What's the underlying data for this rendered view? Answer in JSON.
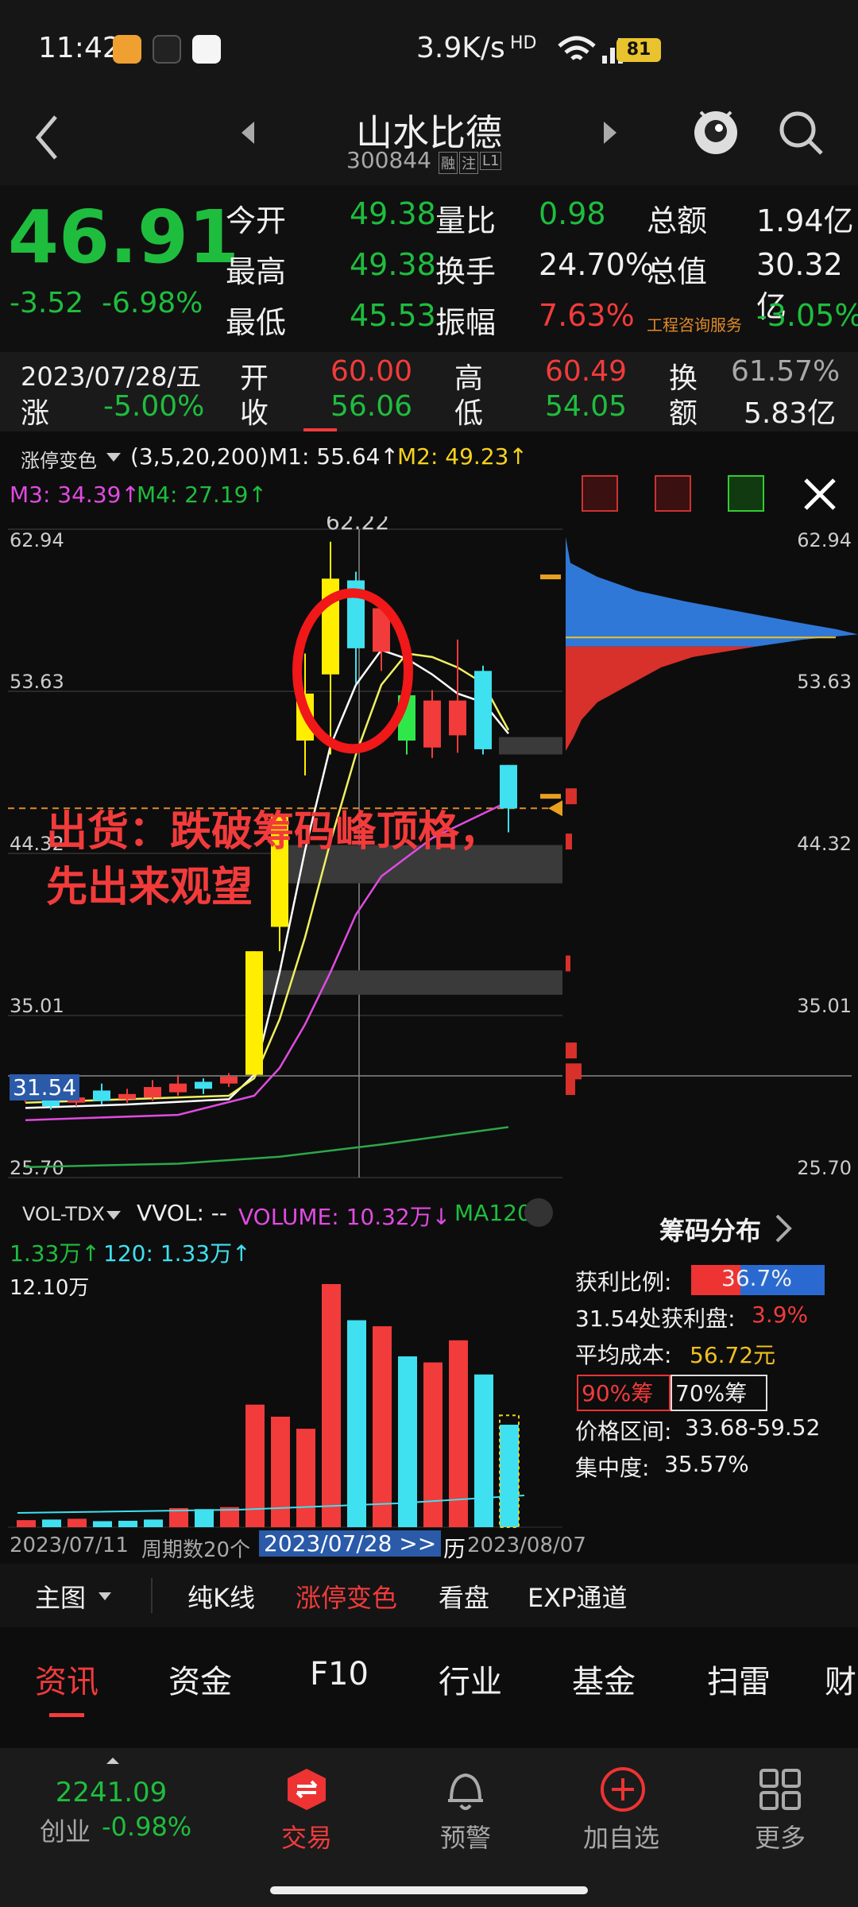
{
  "status": {
    "time": "11:42",
    "speed": "3.9K/s",
    "network": "HD",
    "battery": "81"
  },
  "header": {
    "title": "山水比德",
    "code": "300844",
    "badges": [
      "融",
      "注",
      "L1"
    ]
  },
  "quote": {
    "price": "46.91",
    "change": "-3.52",
    "change_pct": "-6.98%",
    "rows": [
      [
        {
          "l": "今开",
          "v": "49.38",
          "vc": "g"
        },
        {
          "l": "量比",
          "v": "0.98",
          "vc": "g"
        },
        {
          "l": "总额",
          "v": "1.94亿",
          "vc": "w"
        }
      ],
      [
        {
          "l": "最高",
          "v": "49.38",
          "vc": "g"
        },
        {
          "l": "换手",
          "v": "24.70%",
          "vc": "w"
        },
        {
          "l": "总值",
          "v": "30.32亿",
          "vc": "w"
        }
      ],
      [
        {
          "l": "最低",
          "v": "45.53",
          "vc": "g"
        },
        {
          "l": "振幅",
          "v": "7.63%",
          "vc": "r"
        },
        {
          "l": "工程咨询服务",
          "v": "-3.05%",
          "vc": "g"
        }
      ]
    ]
  },
  "hist": {
    "date": "2023/07/28/五",
    "chg_label": "涨",
    "chg": "-5.00%",
    "open_l": "开",
    "open": "60.00",
    "close_l": "收",
    "close": "56.06",
    "high_l": "高",
    "high": "60.49",
    "low_l": "低",
    "low": "54.05",
    "turn_l": "换",
    "turn": "61.57%",
    "amt_l": "额",
    "amt": "5.83亿"
  },
  "main_ind": {
    "name": "涨停变色",
    "params": "(3,5,20,200)",
    "m1": "M1: 55.64↑",
    "m2": "M2: 49.23↑",
    "m3": "M3: 34.39↑",
    "m4": "M4: 27.19↑"
  },
  "price_axis": [
    "62.94",
    "53.63",
    "44.32",
    "35.01",
    "25.70"
  ],
  "high_mark": "62.22",
  "cursor_price": "31.54",
  "annotation": [
    "出货：跌破筹码峰顶格，",
    "先出来观望"
  ],
  "vol_ind": {
    "name": "VOL-TDX",
    "vvol": "VVOL: --",
    "volume": "VOLUME: 10.32万↓",
    "ma120": "MA120:",
    "ma_val": "1.33万↑",
    "ma120b": "120: 1.33万↑",
    "max": "12.10万"
  },
  "xaxis": {
    "start": "2023/07/11",
    "period": "周期数20个",
    "cursor": "2023/07/28 >>",
    "hist": "历",
    "end": "2023/08/07"
  },
  "chip": {
    "title": "筹码分布",
    "profit_ratio_l": "获利比例:",
    "profit_ratio": "36.7%",
    "profit_pct": 0.367,
    "at_price": "31.54处获利盘:",
    "at_val": "3.9%",
    "avg_l": "平均成本:",
    "avg": "56.72元",
    "tab90": "90%筹",
    "tab70": "70%筹",
    "range_l": "价格区间:",
    "range": "33.68-59.52",
    "conc_l": "集中度:",
    "conc": "35.57%"
  },
  "toolbar": {
    "main": "主图",
    "items": [
      "纯K线",
      "涨停变色",
      "看盘",
      "EXP通道"
    ]
  },
  "tabs": [
    "资讯",
    "资金",
    "F10",
    "行业",
    "基金",
    "扫雷",
    "财"
  ],
  "bottom": {
    "index_val": "2241.09",
    "index_name": "创业",
    "index_chg": "-0.98%",
    "trade": "交易",
    "alert": "预警",
    "add": "加自选",
    "more": "更多"
  },
  "chart_data": {
    "type": "candlestick",
    "ylim": [
      25.7,
      62.94
    ],
    "candles": [
      {
        "o": 30.6,
        "c": 30.3,
        "h": 30.9,
        "l": 30.0,
        "col": "r"
      },
      {
        "o": 30.5,
        "c": 29.8,
        "h": 30.8,
        "l": 29.6,
        "col": "c"
      },
      {
        "o": 30.0,
        "c": 30.3,
        "h": 30.6,
        "l": 29.8,
        "col": "r"
      },
      {
        "o": 30.7,
        "c": 30.1,
        "h": 31.1,
        "l": 29.9,
        "col": "c"
      },
      {
        "o": 30.2,
        "c": 30.5,
        "h": 30.8,
        "l": 30.0,
        "col": "r"
      },
      {
        "o": 30.3,
        "c": 30.9,
        "h": 31.3,
        "l": 30.1,
        "col": "r"
      },
      {
        "o": 30.6,
        "c": 31.1,
        "h": 31.6,
        "l": 30.4,
        "col": "r"
      },
      {
        "o": 31.2,
        "c": 30.8,
        "h": 31.4,
        "l": 30.5,
        "col": "c"
      },
      {
        "o": 31.1,
        "c": 31.5,
        "h": 31.7,
        "l": 30.9,
        "col": "r"
      },
      {
        "o": 31.6,
        "c": 38.7,
        "h": 38.7,
        "l": 31.6,
        "col": "y"
      },
      {
        "o": 40.1,
        "c": 46.5,
        "h": 46.5,
        "l": 38.7,
        "col": "y"
      },
      {
        "o": 50.8,
        "c": 53.5,
        "h": 55.8,
        "l": 48.8,
        "col": "y"
      },
      {
        "o": 54.6,
        "c": 60.1,
        "h": 62.22,
        "l": 50.0,
        "col": "y"
      },
      {
        "o": 56.1,
        "c": 60.0,
        "h": 60.5,
        "l": 54.1,
        "col": "c"
      },
      {
        "o": 58.4,
        "c": 55.9,
        "h": 58.9,
        "l": 54.8,
        "col": "r"
      },
      {
        "o": 53.4,
        "c": 50.8,
        "h": 53.6,
        "l": 50.0,
        "col": "g"
      },
      {
        "o": 53.1,
        "c": 50.4,
        "h": 53.7,
        "l": 49.8,
        "col": "r"
      },
      {
        "o": 53.1,
        "c": 51.1,
        "h": 56.6,
        "l": 50.1,
        "col": "r"
      },
      {
        "o": 54.8,
        "c": 50.3,
        "h": 55.1,
        "l": 50.0,
        "col": "c"
      },
      {
        "o": 49.4,
        "c": 46.9,
        "h": 49.4,
        "l": 45.53,
        "col": "c"
      }
    ],
    "volumes": [
      0.35,
      0.38,
      0.42,
      0.3,
      0.32,
      0.38,
      0.95,
      0.9,
      1.0,
      6.1,
      5.5,
      4.9,
      12.1,
      10.3,
      10.0,
      8.5,
      8.2,
      9.3,
      7.6,
      5.1
    ],
    "vol_colors": [
      "r",
      "c",
      "r",
      "c",
      "c",
      "c",
      "r",
      "c",
      "r",
      "r",
      "r",
      "r",
      "r",
      "c",
      "r",
      "c",
      "r",
      "r",
      "c",
      "c"
    ]
  }
}
